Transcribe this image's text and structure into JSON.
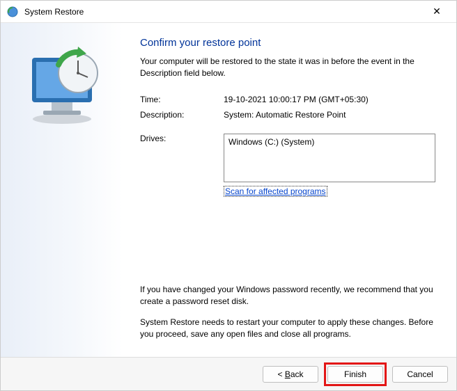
{
  "titlebar": {
    "title": "System Restore"
  },
  "heading": "Confirm your restore point",
  "intro": "Your computer will be restored to the state it was in before the event in the Description field below.",
  "fields": {
    "time_label": "Time:",
    "time_value": "19-10-2021 10:00:17 PM (GMT+05:30)",
    "desc_label": "Description:",
    "desc_value": "System: Automatic Restore Point",
    "drives_label": "Drives:",
    "drives_value": "Windows (C:) (System)"
  },
  "scan_link": "Scan for affected programs",
  "note1": "If you have changed your Windows password recently, we recommend that you create a password reset disk.",
  "note2": "System Restore needs to restart your computer to apply these changes. Before you proceed, save any open files and close all programs.",
  "buttons": {
    "back_prefix": "< ",
    "back_u": "B",
    "back_rest": "ack",
    "finish": "Finish",
    "cancel": "Cancel"
  }
}
